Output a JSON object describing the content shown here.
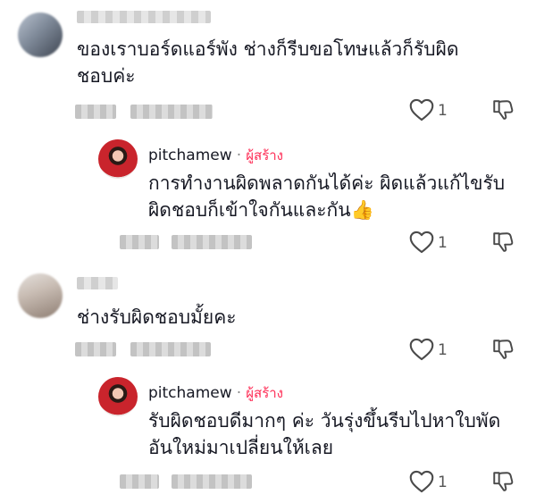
{
  "comments": [
    {
      "text_line1": "ของเราบอร์ดแอร์พัง ช่างก็รีบขอโทษแล้วก็รับผิด",
      "text_line2": "ชอบค่ะ",
      "likes": "1",
      "reply": {
        "username": "pitchamew",
        "separator": "·",
        "creator_label": "ผู้สร้าง",
        "text_line1": "การทำงานผิดพลาดกันได้ค่ะ ผิดแล้วแก้ไขรับ",
        "text_line2": "ผิดชอบก็เข้าใจกันและกัน",
        "emoji": "👍",
        "likes": "1"
      }
    },
    {
      "text_line1": "ช่างรับผิดชอบมั้ยคะ",
      "likes": "1",
      "reply": {
        "username": "pitchamew",
        "separator": "·",
        "creator_label": "ผู้สร้าง",
        "text_line1": "รับผิดชอบดีมากๆ ค่ะ วันรุ่งขึ้นรีบไปหาใบพัด",
        "text_line2": "อันใหม่มาเปลี่ยนให้เลย",
        "likes": "1"
      }
    }
  ],
  "icons": {
    "like": "heart-outline-icon",
    "dislike": "thumbs-down-icon"
  },
  "colors": {
    "creator_label": "#fe2c55",
    "text": "#161823",
    "secondary": "#555555"
  }
}
